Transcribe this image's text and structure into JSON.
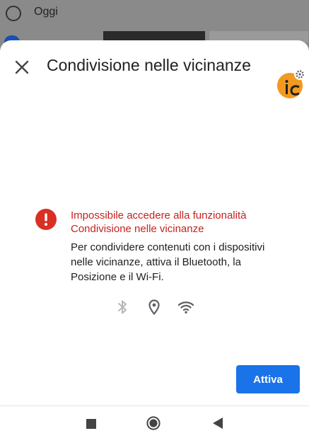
{
  "background": {
    "list_label": "Oggi"
  },
  "sheet": {
    "title": "Condivisione nelle vicinanze",
    "error_title": "Impossibile accedere alla funzionalità Condivisione nelle vicinanze",
    "error_description": "Per condividere contenuti con i dispositivi nelle vicinanze, attiva il Bluetooth, la Posizione e il Wi-Fi.",
    "status_icons": [
      "bluetooth-icon",
      "location-icon",
      "wifi-icon"
    ],
    "action_label": "Attiva"
  },
  "colors": {
    "accent": "#1a73e8",
    "error": "#c5221f",
    "avatar": "#f29a1f"
  }
}
